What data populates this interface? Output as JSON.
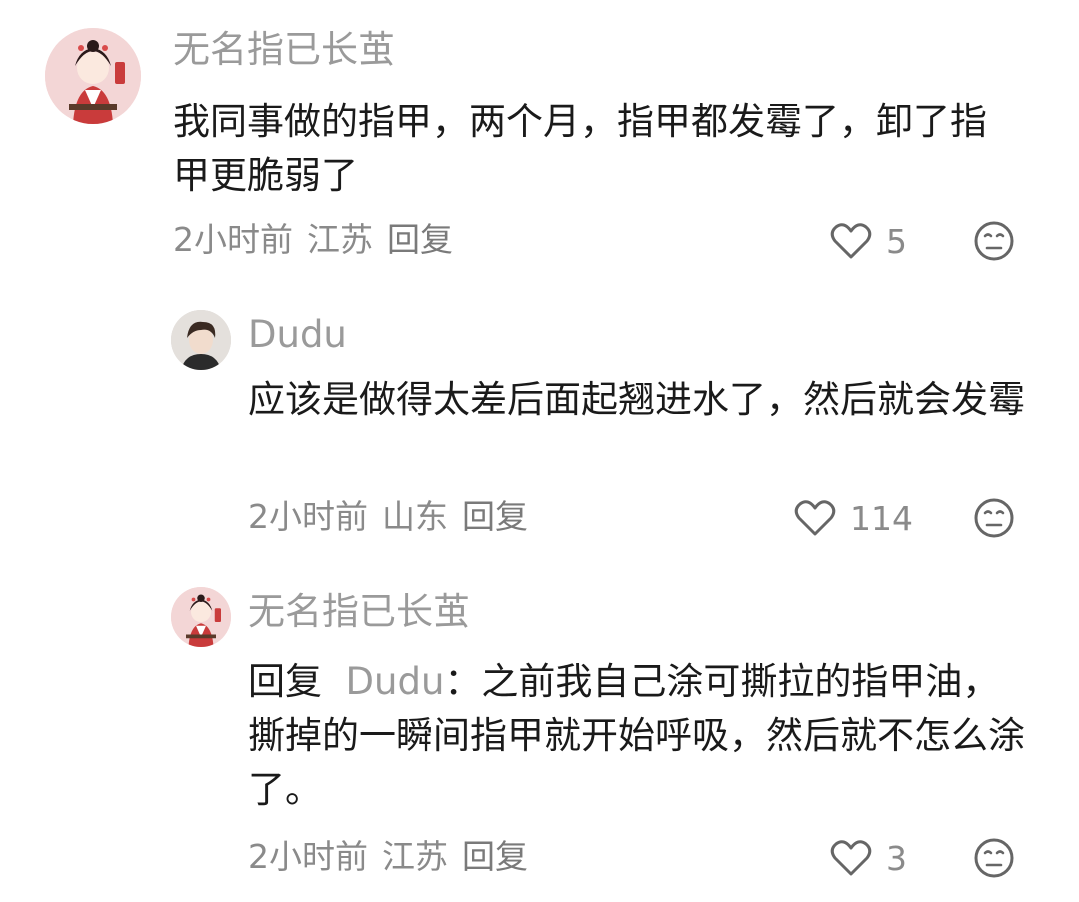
{
  "comments": [
    {
      "username": "无名指已长茧",
      "text": "我同事做的指甲，两个月，指甲都发霉了，卸了指甲更脆弱了",
      "time": "2小时前",
      "location": "江苏",
      "reply_label": "回复",
      "likes": "5",
      "avatar_icon": "hanfu-girl-avatar"
    },
    {
      "username": "Dudu",
      "text": "应该是做得太差后面起翘进水了，然后就会发霉",
      "time": "2小时前",
      "location": "山东",
      "reply_label": "回复",
      "likes": "114",
      "avatar_icon": "young-man-avatar"
    },
    {
      "username": "无名指已长茧",
      "reply_prefix": "回复",
      "reply_target": "Dudu",
      "reply_colon": "：",
      "text": "之前我自己涂可撕拉的指甲油，撕掉的一瞬间指甲就开始呼吸，然后就不怎么涂了。",
      "time": "2小时前",
      "location": "江苏",
      "reply_label": "回复",
      "likes": "3",
      "avatar_icon": "hanfu-girl-avatar"
    }
  ],
  "colors": {
    "text": "#1a1a1a",
    "muted": "#9a9a9a",
    "icon": "#666666"
  },
  "icons": [
    "heart-outline-icon",
    "meh-face-icon"
  ]
}
